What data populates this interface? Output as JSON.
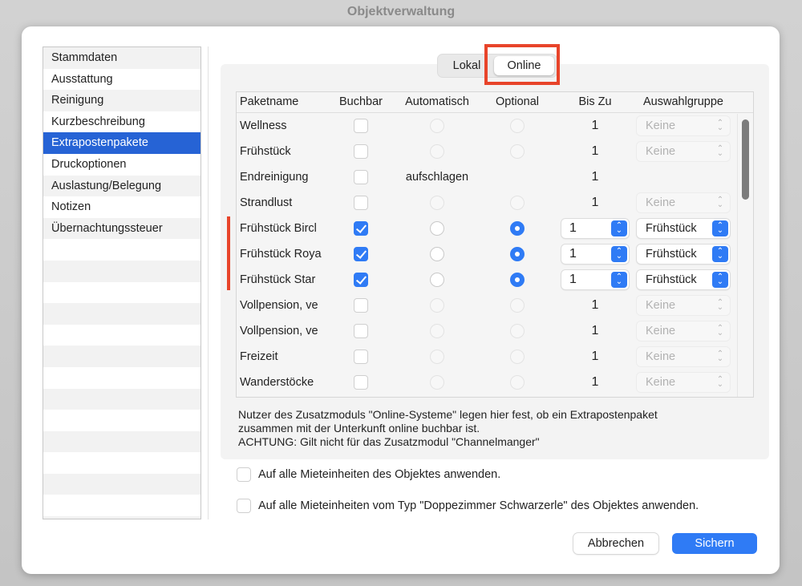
{
  "window": {
    "title": "Objektverwaltung"
  },
  "sidebar": {
    "items": [
      {
        "label": "Stammdaten",
        "selected": false
      },
      {
        "label": "Ausstattung",
        "selected": false
      },
      {
        "label": "Reinigung",
        "selected": false
      },
      {
        "label": "Kurzbeschreibung",
        "selected": false
      },
      {
        "label": "Extrapostenpakete",
        "selected": true
      },
      {
        "label": "Druckoptionen",
        "selected": false
      },
      {
        "label": "Auslastung/Belegung",
        "selected": false
      },
      {
        "label": "Notizen",
        "selected": false
      },
      {
        "label": "Übernachtungssteuer",
        "selected": false
      }
    ]
  },
  "segmented": {
    "tabs": [
      {
        "label": "Lokal",
        "selected": false
      },
      {
        "label": "Online",
        "selected": true
      }
    ]
  },
  "table": {
    "columns": [
      "Paketname",
      "Buchbar",
      "Automatisch",
      "Optional",
      "Bis Zu",
      "Auswahlgruppe"
    ],
    "rows": [
      {
        "name": "Wellness",
        "buchbar": false,
        "automatisch": "radio-disabled",
        "optional": "radio-disabled",
        "bis_zu": "1",
        "bis_editable": false,
        "gruppe": "Keine",
        "gruppe_enabled": false
      },
      {
        "name": "Frühstück",
        "buchbar": false,
        "automatisch": "radio-disabled",
        "optional": "radio-disabled",
        "bis_zu": "1",
        "bis_editable": false,
        "gruppe": "Keine",
        "gruppe_enabled": false
      },
      {
        "name": "Endreinigung",
        "buchbar": false,
        "automatisch": "aufschlagen",
        "optional": "none",
        "bis_zu": "1",
        "bis_editable": false,
        "gruppe": null,
        "gruppe_enabled": false
      },
      {
        "name": "Strandlust",
        "buchbar": false,
        "automatisch": "radio-disabled",
        "optional": "radio-disabled",
        "bis_zu": "1",
        "bis_editable": false,
        "gruppe": "Keine",
        "gruppe_enabled": false
      },
      {
        "name": "Frühstück Birchermüsli",
        "display_name": "Frühstück Bircl",
        "buchbar": true,
        "automatisch": "radio",
        "optional": "radio-selected",
        "bis_zu": "1",
        "bis_editable": true,
        "gruppe": "Frühstück",
        "gruppe_enabled": true
      },
      {
        "name": "Frühstück Royal",
        "display_name": "Frühstück Roya",
        "buchbar": true,
        "automatisch": "radio",
        "optional": "radio-selected",
        "bis_zu": "1",
        "bis_editable": true,
        "gruppe": "Frühstück",
        "gruppe_enabled": true
      },
      {
        "name": "Frühstück Standard",
        "display_name": "Frühstück Star",
        "buchbar": true,
        "automatisch": "radio",
        "optional": "radio-selected",
        "bis_zu": "1",
        "bis_editable": true,
        "gruppe": "Frühstück",
        "gruppe_enabled": true
      },
      {
        "name": "Vollpension, ve",
        "display_name": "Vollpension, ve",
        "buchbar": false,
        "automatisch": "radio-disabled",
        "optional": "radio-disabled",
        "bis_zu": "1",
        "bis_editable": false,
        "gruppe": "Keine",
        "gruppe_enabled": false
      },
      {
        "name": "Vollpension, ve",
        "display_name": "Vollpension, ve",
        "buchbar": false,
        "automatisch": "radio-disabled",
        "optional": "radio-disabled",
        "bis_zu": "1",
        "bis_editable": false,
        "gruppe": "Keine",
        "gruppe_enabled": false
      },
      {
        "name": "Freizeit",
        "buchbar": false,
        "automatisch": "radio-disabled",
        "optional": "radio-disabled",
        "bis_zu": "1",
        "bis_editable": false,
        "gruppe": "Keine",
        "gruppe_enabled": false
      },
      {
        "name": "Wanderstöcke",
        "buchbar": false,
        "automatisch": "radio-disabled",
        "optional": "radio-disabled",
        "bis_zu": "1",
        "bis_editable": false,
        "gruppe": "Keine",
        "gruppe_enabled": false
      }
    ]
  },
  "info": {
    "line1": "Nutzer des Zusatzmoduls \"Online-Systeme\" legen hier fest, ob ein Extrapostenpaket",
    "line2": "zusammen mit der Unterkunft online buchbar ist.",
    "line3": "ACHTUNG: Gilt nicht für das Zusatzmodul \"Channelmanger\""
  },
  "apply_options": {
    "all_units": {
      "label": "Auf alle Mieteinheiten des Objektes anwenden.",
      "checked": false
    },
    "type_units": {
      "label": "Auf alle Mieteinheiten vom Typ \"Doppezimmer Schwarzerle\" des Objektes anwenden.",
      "checked": false
    }
  },
  "buttons": {
    "cancel": "Abbrechen",
    "save": "Sichern"
  },
  "colors": {
    "accent": "#2f7bf5",
    "selection": "#2663d5",
    "annotation": "#e8442a"
  }
}
